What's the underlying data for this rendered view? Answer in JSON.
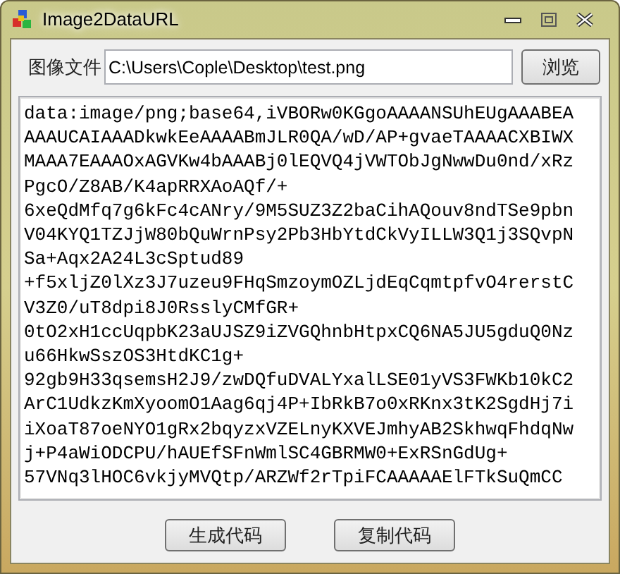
{
  "window": {
    "title": "Image2DataURL"
  },
  "file": {
    "label": "图像文件",
    "value": "C:\\Users\\Cople\\Desktop\\test.png",
    "browse_button": "浏览"
  },
  "output_lines": [
    "data:image/png;base64,iVBORw0KGgoAAAANSUhEUgAAABEA",
    "AAAUCAIAAADkwkEeAAAABmJLR0QA/wD/AP+gvaeTAAAACXBIWX",
    "MAAA7EAAAOxAGVKw4bAAABj0lEQVQ4jVWTObJgNwwDu0nd/xRz",
    "PgcO/Z8AB/K4apRRXAoAQf/+",
    "6xeQdMfq7g6kFc4cANry/9M5SUZ3Z2baCihAQouv8ndTSe9pbn",
    "V04KYQ1TZJjW80bQuWrnPsy2Pb3HbYtdCkVyILLW3Q1j3SQvpN",
    "Sa+Aqx2A24L3cSptud89",
    "+f5xljZ0lXz3J7uzeu9FHqSmzoymOZLjdEqCqmtpfvO4rerstC",
    "V3Z0/uT8dpi8J0RsslyCMfGR+",
    "0tO2xH1ccUqpbK23aUJSZ9iZVGQhnbHtpxCQ6NA5JU5gduQ0Nz",
    "u66HkwSszOS3HtdKC1g+",
    "92gb9H33qsemsH2J9/zwDQfuDVALYxalLSE01yVS3FWKb10kC2",
    "ArC1UdkzKmXyoomO1Aag6qj4P+IbRkB7o0xRKnx3tK2SgdHj7i",
    "iXoaT87oeNYO1gRx2bqyzxVZELnyKXVEJmhyAB2SkhwqFhdqNw",
    "j+P4aWiODCPU/hAUEfSFnWmlSC4GBRMW0+ExRSnGdUg+",
    "57VNq3lHOC6vkjyMVQtp/ARZWf2rTpiFCAAAAAElFTkSuQmCC"
  ],
  "buttons": [
    "生成代码",
    "复制代码"
  ]
}
